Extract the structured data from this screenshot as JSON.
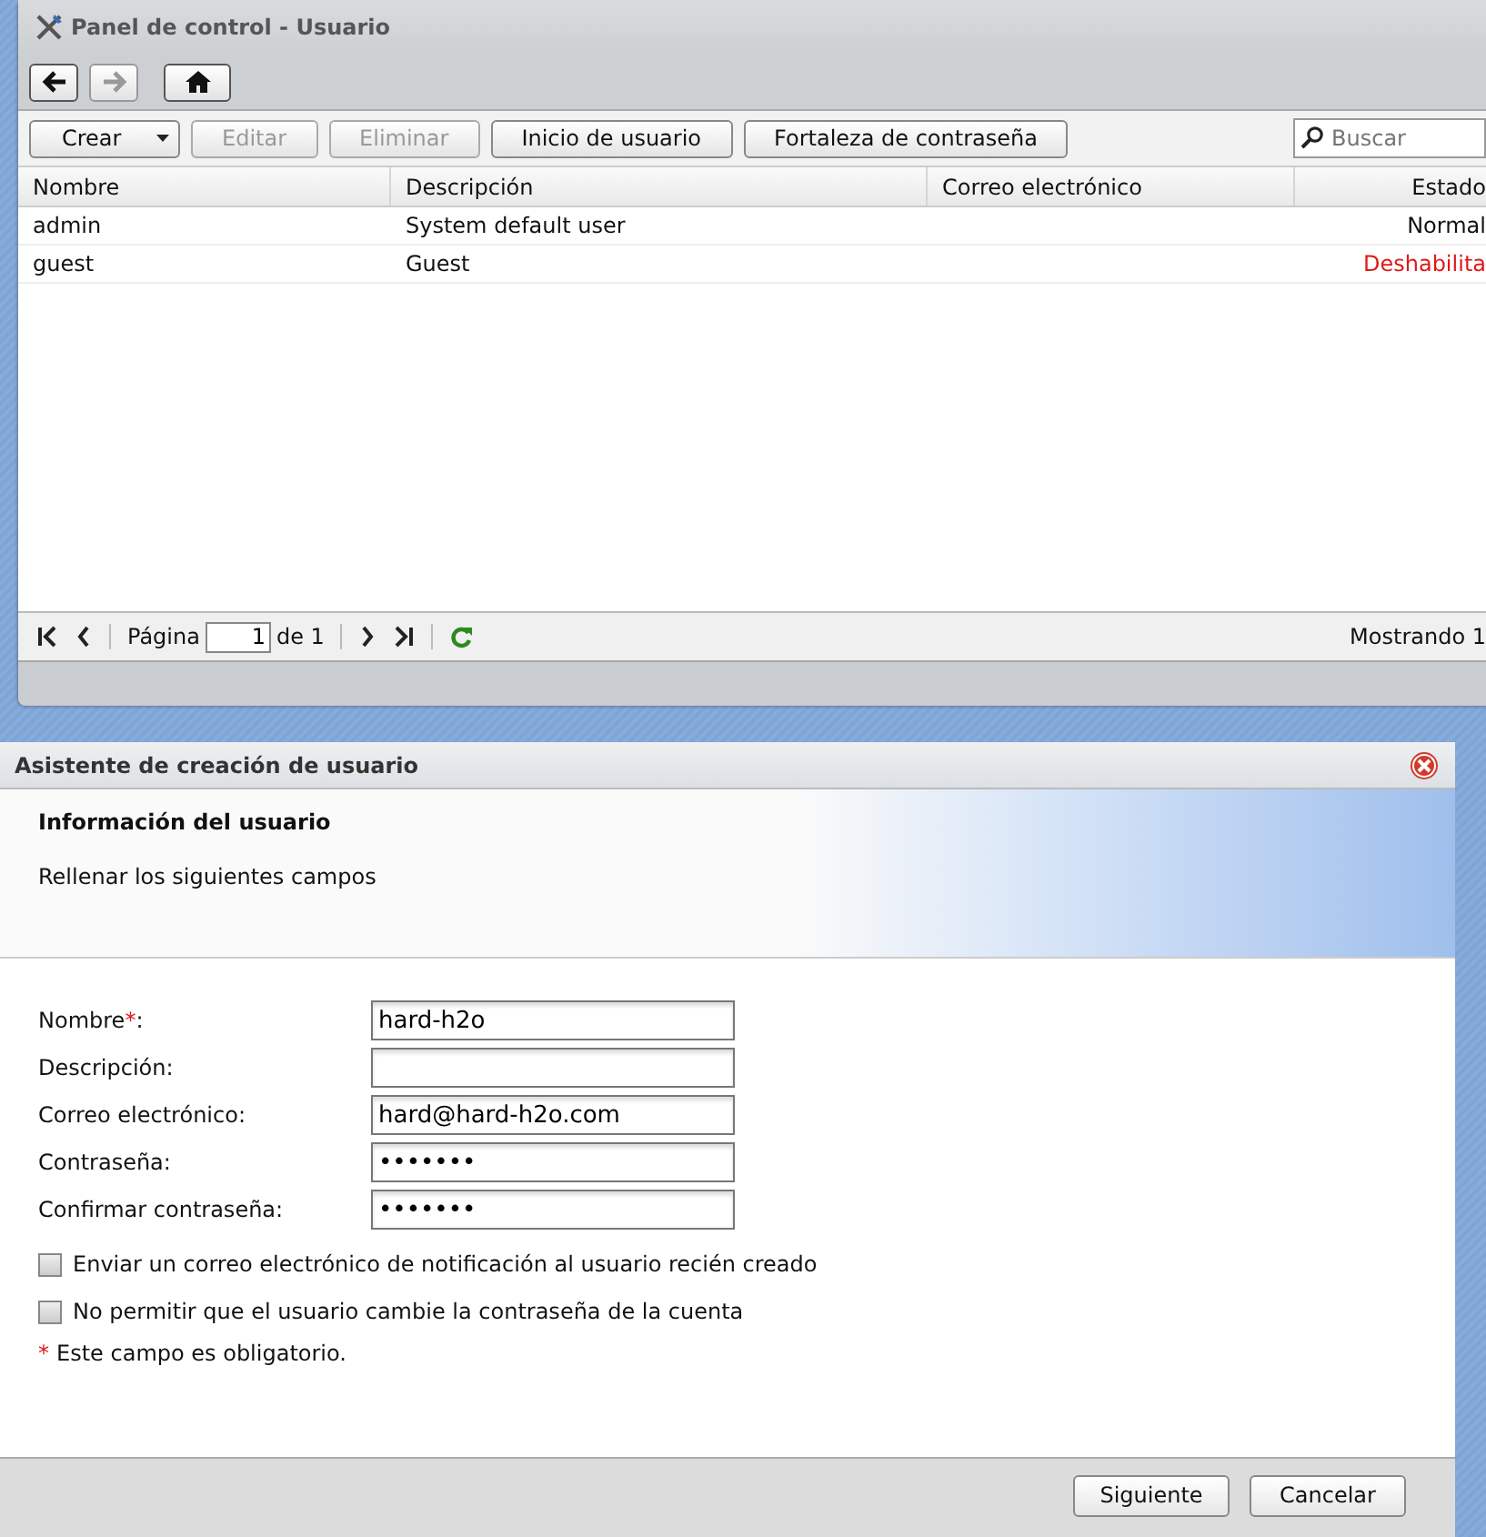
{
  "main_window": {
    "title": "Panel de control - Usuario",
    "nav": [
      {
        "kind": "back",
        "disabled": false
      },
      {
        "kind": "forward",
        "disabled": true
      },
      {
        "kind": "home",
        "disabled": false
      }
    ],
    "toolbar": [
      {
        "label": "Crear",
        "kind": "dropdown",
        "disabled": false
      },
      {
        "label": "Editar",
        "kind": "plain",
        "disabled": true
      },
      {
        "label": "Eliminar",
        "kind": "plain",
        "disabled": true
      },
      {
        "label": "Inicio de usuario",
        "kind": "plain",
        "disabled": false
      },
      {
        "label": "Fortaleza de contraseña",
        "kind": "plain",
        "disabled": false
      }
    ],
    "search": {
      "placeholder": "Buscar"
    },
    "table": {
      "columns": [
        "Nombre",
        "Descripción",
        "Correo electrónico",
        "Estado"
      ],
      "rows": [
        {
          "name": "admin",
          "description": "System default user",
          "status": "Normal",
          "disabled": false
        },
        {
          "name": "guest",
          "description": "Guest",
          "status": "Deshabilita",
          "disabled": true
        }
      ]
    },
    "paging": {
      "page_label": "Página",
      "page": "1",
      "of_label": "de 1",
      "showing": "Mostrando 1"
    }
  },
  "dialog": {
    "title": "Asistente de creación de usuario",
    "heading": "Información del usuario",
    "subheading": "Rellenar los siguientes campos",
    "fields": [
      {
        "label": "Nombre",
        "required_mark": "*",
        "label_end": ":",
        "value": "hard-h2o"
      },
      {
        "label": "Descripción:"
      },
      {
        "label": "Correo electrónico:",
        "value": "hard@hard-h2o.com"
      },
      {
        "label": "Contraseña:",
        "value": "•••••••"
      },
      {
        "label": "Confirmar contraseña:",
        "value": "•••••••"
      }
    ],
    "options": [
      {
        "label": "Enviar un correo electrónico de notificación al usuario recién creado",
        "checked": false
      },
      {
        "label": "No permitir que el usuario cambie la contraseña de la cuenta",
        "checked": false
      }
    ],
    "required_mark": "*",
    "required_note": "Este campo es obligatorio.",
    "buttons": [
      "Siguiente",
      "Cancelar"
    ]
  }
}
